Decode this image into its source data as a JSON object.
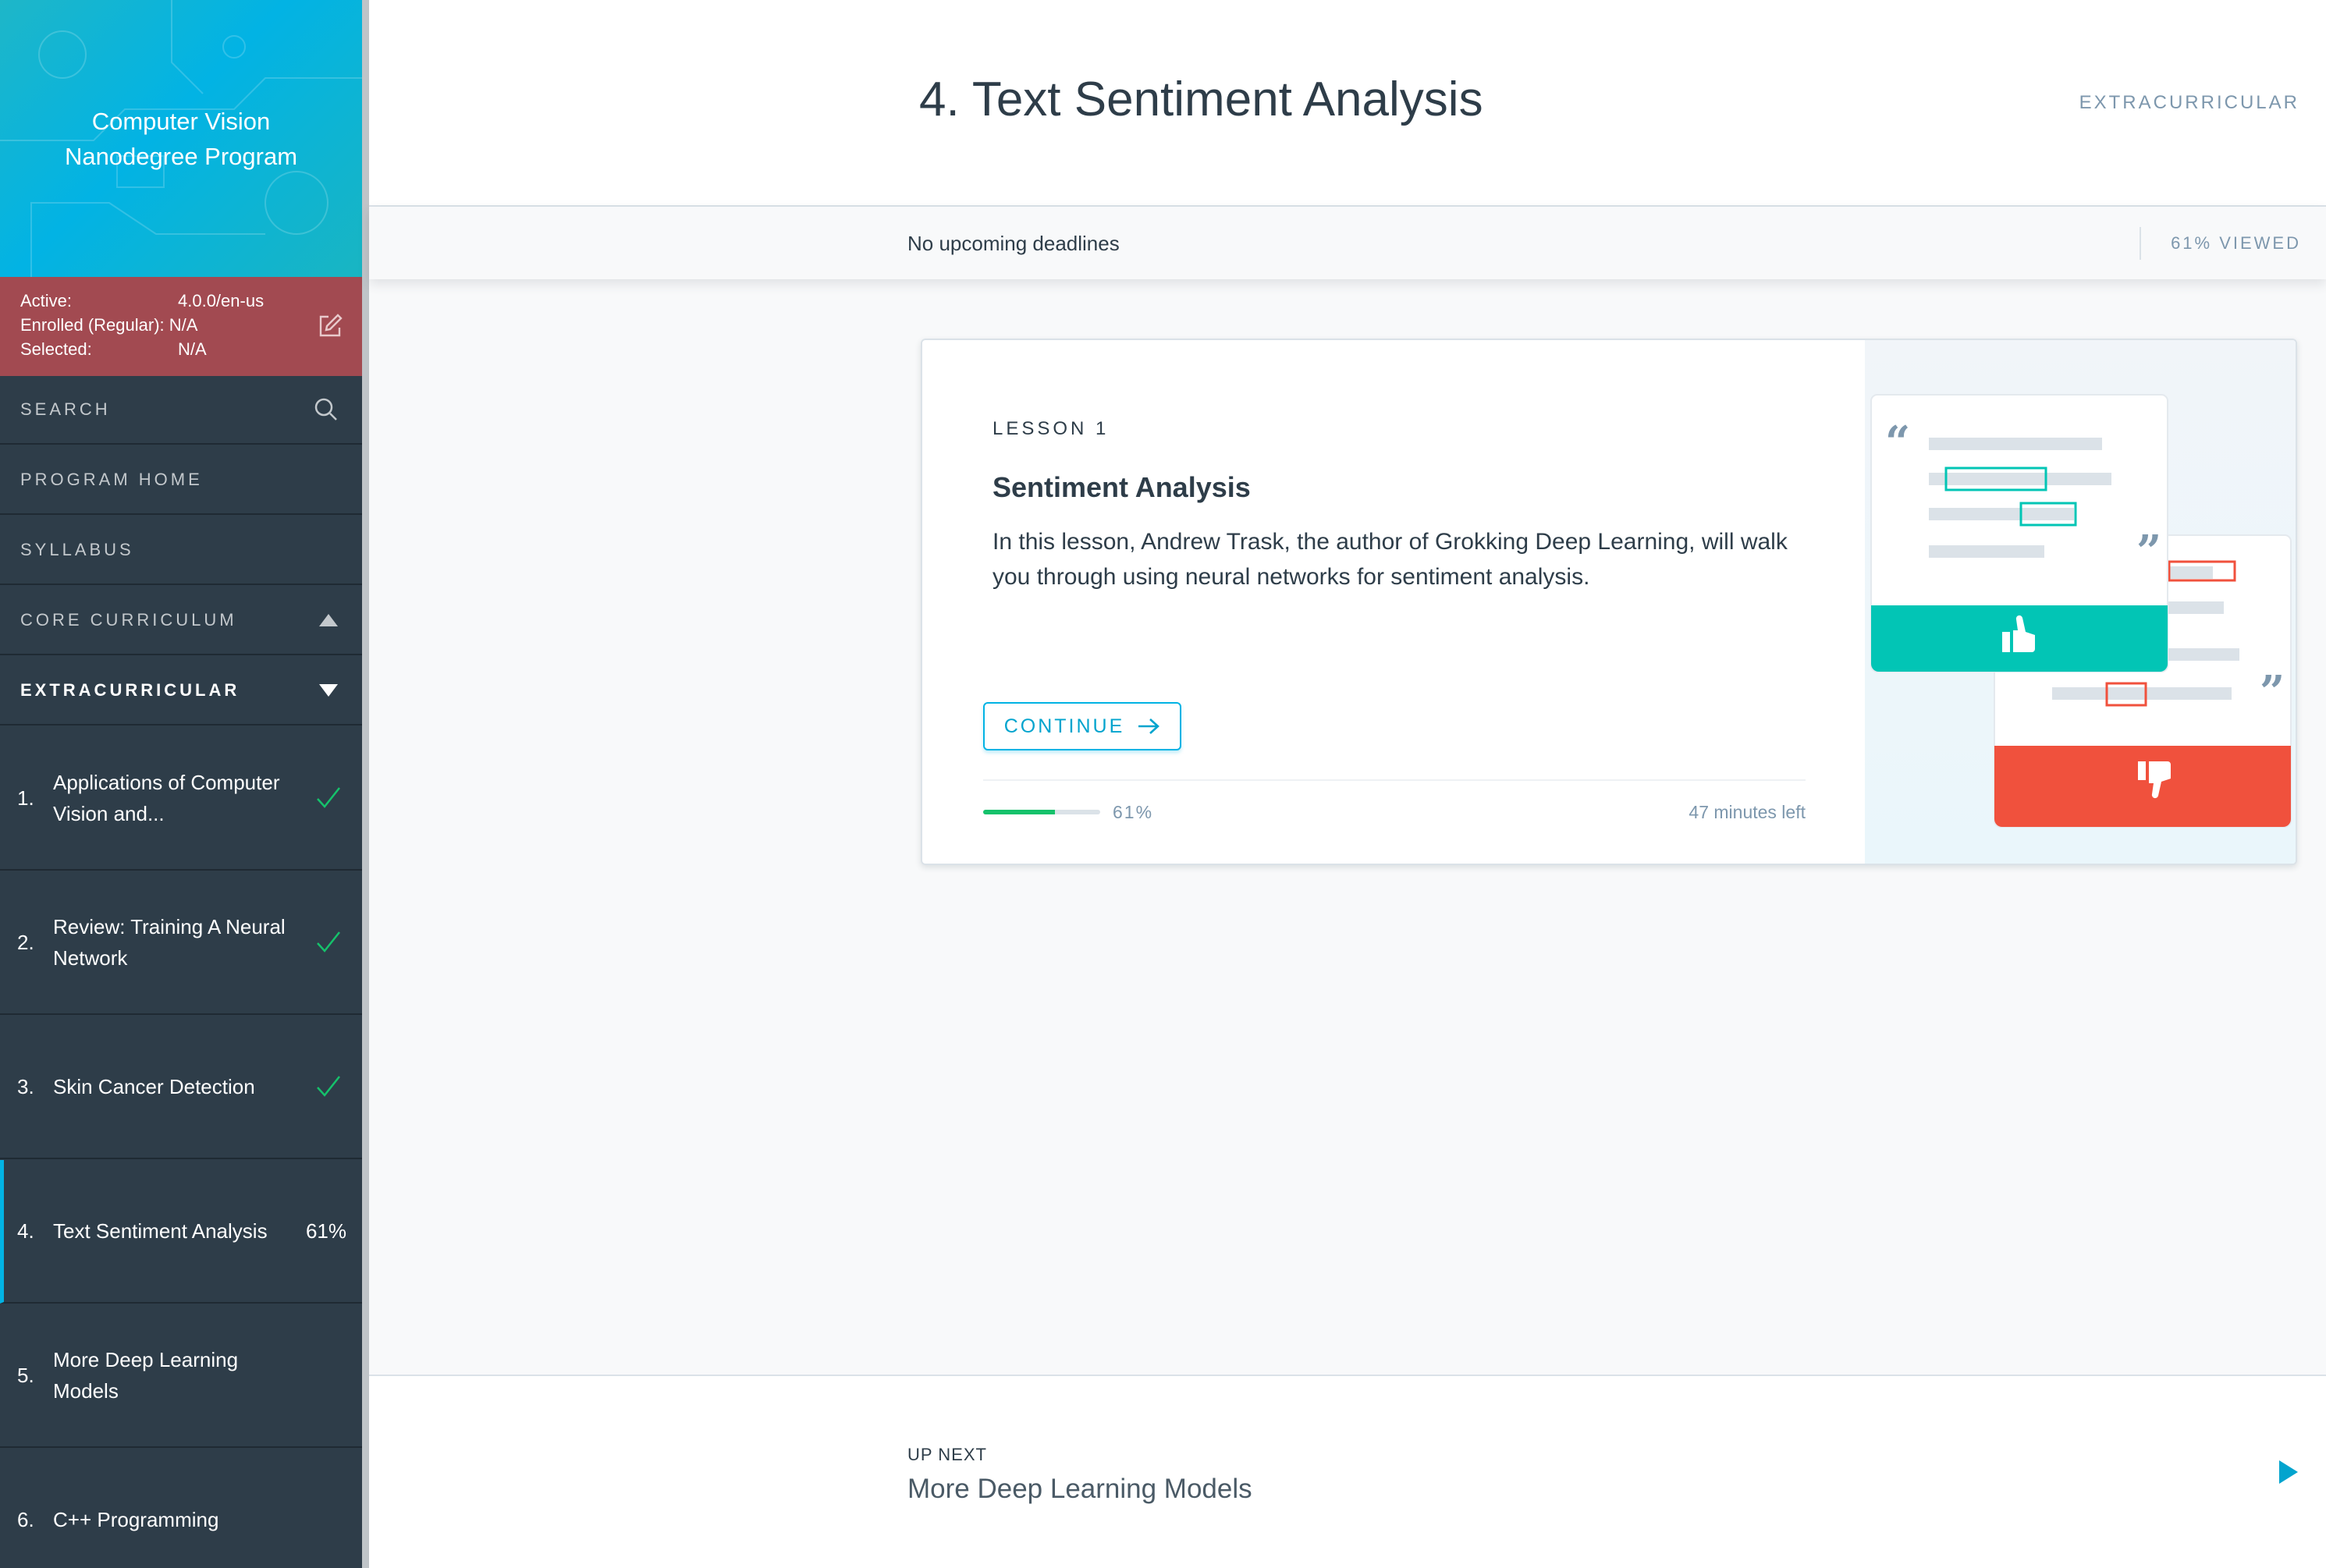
{
  "sidebar": {
    "brand_line1": "Computer Vision",
    "brand_line2": "Nanodegree Program",
    "version": {
      "active_label": "Active:",
      "active_value": "4.0.0/en-us",
      "enrolled_label": "Enrolled (Regular):",
      "enrolled_value": "N/A",
      "selected_label": "Selected:",
      "selected_value": "N/A"
    },
    "nav": {
      "search": "SEARCH",
      "program_home": "PROGRAM HOME",
      "syllabus": "SYLLABUS",
      "core_curriculum": "CORE CURRICULUM",
      "extracurricular": "EXTRACURRICULAR"
    },
    "lessons": [
      {
        "num": "1.",
        "title": "Applications of Computer Vision and...",
        "status": "complete"
      },
      {
        "num": "2.",
        "title": "Review: Training A Neural Network",
        "status": "complete"
      },
      {
        "num": "3.",
        "title": "Skin Cancer Detection",
        "status": "complete"
      },
      {
        "num": "4.",
        "title": "Text Sentiment Analysis",
        "status": "current",
        "progress": "61%"
      },
      {
        "num": "5.",
        "title": "More Deep Learning Models",
        "status": "none"
      },
      {
        "num": "6.",
        "title": "C++ Programming",
        "status": "none"
      }
    ]
  },
  "header": {
    "title": "4. Text Sentiment Analysis",
    "section": "EXTRACURRICULAR",
    "deadlines": "No upcoming deadlines",
    "viewed": "61% VIEWED"
  },
  "card": {
    "kicker": "LESSON 1",
    "title": "Sentiment Analysis",
    "description": "In this lesson, Andrew Trask, the author of Grokking Deep Learning, will walk you through using neural networks for sentiment analysis.",
    "continue_label": "CONTINUE",
    "progress_fraction": 0.61,
    "progress_label": "61%",
    "time_left": "47 minutes left"
  },
  "up_next": {
    "kicker": "UP NEXT",
    "title": "More Deep Learning Models"
  },
  "colors": {
    "accent": "#02b3e4",
    "sidebar_bg": "#2e3d49",
    "version_bg": "#a24a51",
    "success": "#15c26b",
    "positive": "#02c5b5",
    "negative": "#f0513d"
  },
  "icons": {
    "search": "search-icon",
    "edit": "edit-icon",
    "collapse": "caret-up-icon",
    "expand": "caret-down-icon",
    "check": "check-icon",
    "arrow": "arrow-right-icon",
    "next": "play-triangle-icon"
  }
}
